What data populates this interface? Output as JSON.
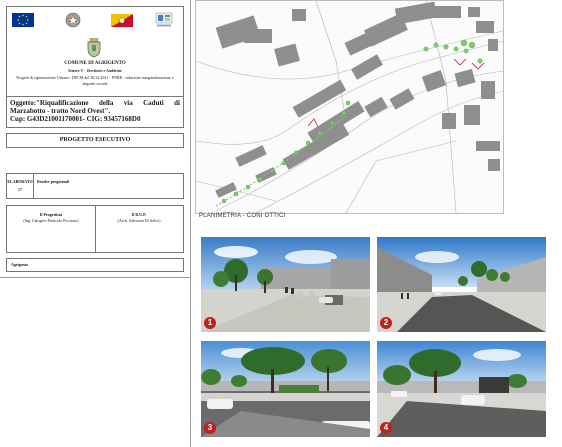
{
  "title_block": {
    "municipality": "COMUNE DI AGRIGENTO",
    "department": "Settore V - Territorio e Ambiente",
    "program": "Progetti di rigenerazione Urbana - DPCM del 30/12/2021 - PNRR - riduzione marginalizzazione e degrado sociale",
    "subject": "Oggetto:\"Riqualificazione della via Caduti di Marzabotto - tratto Nord Ovest\".",
    "codes": "Cup: G43D21001170001- CIG: 93457168D0",
    "phase": "PROGETTO ESECUTIVO",
    "sheet_label": "ELABORATO",
    "sheet_number": "17",
    "sheet_title": "Render progettuali",
    "designer_role": "Il Progettista",
    "designer_name": "(Ing. Calogero Patricolo Pecoraro)",
    "rup_role": "Il R.U.P.",
    "rup_name": "(Arch. Salvatore Di Salvo)",
    "update_label": "Agrigento"
  },
  "map": {
    "caption": "PLANIMETRIA - CONI OTTICI"
  },
  "renders": [
    {
      "number": "1"
    },
    {
      "number": "2"
    },
    {
      "number": "3"
    },
    {
      "number": "4"
    }
  ],
  "colors": {
    "badge": "#c21f1f",
    "eu_blue": "#003399",
    "sicily_yellow": "#f2c200",
    "sicily_red": "#c8102e",
    "tree_green": "#7ccf6a",
    "building_gray": "#8f8f8f"
  }
}
